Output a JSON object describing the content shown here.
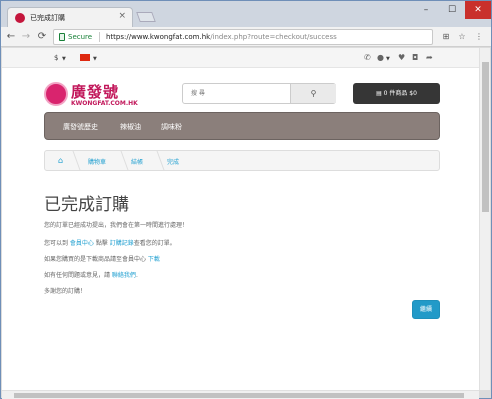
{
  "browser": {
    "tab_title": "已完成訂購",
    "tab_close": "×",
    "window_controls": [
      "–",
      "☐",
      "✕"
    ],
    "back": "←",
    "forward": "→",
    "reload": "⟳",
    "secure_label": "Secure",
    "url_main": "https://www.kwongfat.com.hk",
    "url_rest": "/index.php?route=checkout/success"
  },
  "topbar": {
    "currency": "$"
  },
  "header": {
    "logo_cn": "廣發號",
    "logo_en": "KWONGFAT.COM.HK",
    "search_placeholder": "搜 尋",
    "cart_label": "0 件商品 $0"
  },
  "menu": {
    "items": [
      "廣發號歷史",
      "辣椒油",
      "調味粉"
    ]
  },
  "breadcrumb": {
    "items": [
      "購物車",
      "結帳",
      "完成"
    ]
  },
  "content": {
    "title": "已完成訂購",
    "line1": "您的訂單已經成功提出，我們會在第一時間進行處理！",
    "line2_pre": "您可以到 ",
    "line2_link1": "會員中心",
    "line2_mid": " 點擊 ",
    "line2_link2": "訂購記錄",
    "line2_post": "查看您的訂單。",
    "line3_pre": "如果您購買的是下載商品請至會員中心 ",
    "line3_link": "下載",
    "line4_pre": "如有任何問題或意見，請 ",
    "line4_link": "聯絡我們",
    "line4_post": ".",
    "line5": "多謝您的訂購！",
    "continue_label": "繼續"
  },
  "colors": {
    "accent": "#229ac8",
    "menu_bg": "#8b7f7b",
    "brand": "#c2185b",
    "secure": "#188038"
  }
}
